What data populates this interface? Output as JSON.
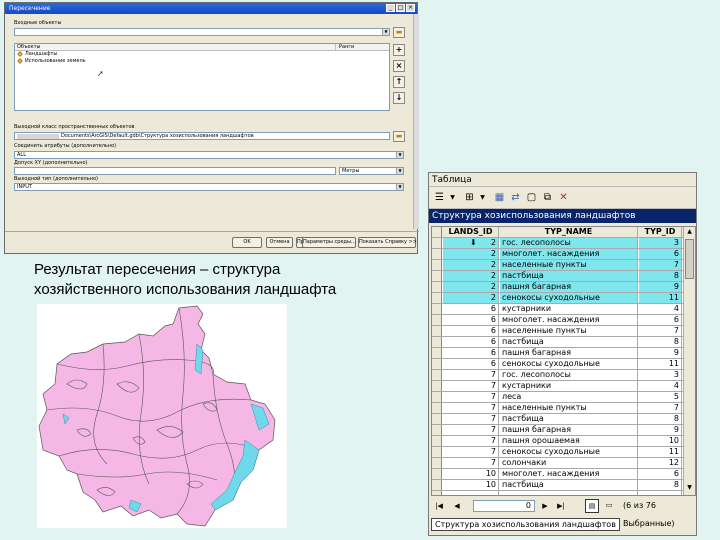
{
  "dialog": {
    "title": "Пересечение",
    "input_label": "Входные объекты",
    "col_objects": "Объекты",
    "col_ranks": "Ранги",
    "items": [
      "Ландшафты",
      "Использование земель"
    ],
    "output_label": "Выходной класс пространственных объектов",
    "output_value": "Documents\\ArcGIS\\Default.gdb\\Структура хозиспользования ландшафтов",
    "attrs_label": "Соединить атрибуты (дополнительно)",
    "attrs_value": "ALL",
    "xy_label": "Допуск XY (дополнительно)",
    "xy_unit": "Метры",
    "type_label": "Выходной тип (дополнительно)",
    "type_value": "INPUT",
    "btn_ok": "OK",
    "btn_cancel": "Отмена",
    "btn_apply": "Применить",
    "btn_env": "Параметры среды...",
    "btn_help": "Показать Справку >>"
  },
  "caption": [
    "Результат пересечения – структура",
    "хозяйственного использования ландшафта"
  ],
  "colors": {
    "map_fill": "#f5b8e6",
    "map_water": "#6fd8ea",
    "selected_row": "#7fe6ee",
    "title_bar": "#0a246a"
  },
  "table": {
    "window_title": "Таблица",
    "table_name": "Структура хозиспользования ландшафтов",
    "headers": [
      "LANDS_ID",
      "TYP_NAME",
      "TYP_ID"
    ],
    "rows": [
      {
        "lands_id": "2",
        "typ_name": "гос. лесополосы",
        "typ_id": "3",
        "selected": true
      },
      {
        "lands_id": "2",
        "typ_name": "многолет. насаждения",
        "typ_id": "6",
        "selected": true
      },
      {
        "lands_id": "2",
        "typ_name": "населенные пункты",
        "typ_id": "7",
        "selected": true
      },
      {
        "lands_id": "2",
        "typ_name": "пастбища",
        "typ_id": "8",
        "selected": true
      },
      {
        "lands_id": "2",
        "typ_name": "пашня багарная",
        "typ_id": "9",
        "selected": true
      },
      {
        "lands_id": "2",
        "typ_name": "сенокосы суходольные",
        "typ_id": "11",
        "selected": true
      },
      {
        "lands_id": "6",
        "typ_name": "кустарники",
        "typ_id": "4",
        "selected": false
      },
      {
        "lands_id": "6",
        "typ_name": "многолет. насаждения",
        "typ_id": "6",
        "selected": false
      },
      {
        "lands_id": "6",
        "typ_name": "населенные пункты",
        "typ_id": "7",
        "selected": false
      },
      {
        "lands_id": "6",
        "typ_name": "пастбища",
        "typ_id": "8",
        "selected": false
      },
      {
        "lands_id": "6",
        "typ_name": "пашня багарная",
        "typ_id": "9",
        "selected": false
      },
      {
        "lands_id": "6",
        "typ_name": "сенокосы суходольные",
        "typ_id": "11",
        "selected": false
      },
      {
        "lands_id": "7",
        "typ_name": "гос. лесополосы",
        "typ_id": "3",
        "selected": false
      },
      {
        "lands_id": "7",
        "typ_name": "кустарники",
        "typ_id": "4",
        "selected": false
      },
      {
        "lands_id": "7",
        "typ_name": "леса",
        "typ_id": "5",
        "selected": false
      },
      {
        "lands_id": "7",
        "typ_name": "населенные пункты",
        "typ_id": "7",
        "selected": false
      },
      {
        "lands_id": "7",
        "typ_name": "пастбища",
        "typ_id": "8",
        "selected": false
      },
      {
        "lands_id": "7",
        "typ_name": "пашня багарная",
        "typ_id": "9",
        "selected": false
      },
      {
        "lands_id": "7",
        "typ_name": "пашня орошаемая",
        "typ_id": "10",
        "selected": false
      },
      {
        "lands_id": "7",
        "typ_name": "сенокосы суходольные",
        "typ_id": "11",
        "selected": false
      },
      {
        "lands_id": "7",
        "typ_name": "солончаки",
        "typ_id": "12",
        "selected": false
      },
      {
        "lands_id": "10",
        "typ_name": "многолет. насаждения",
        "typ_id": "6",
        "selected": false
      },
      {
        "lands_id": "10",
        "typ_name": "пастбища",
        "typ_id": "8",
        "selected": false
      },
      {
        "lands_id": "",
        "typ_name": "",
        "typ_id": "",
        "selected": false
      }
    ],
    "record_field": "0",
    "selection_status": "(6 из 76 Выбранные)",
    "tab_label": "Структура хозиспользования ландшафтов"
  }
}
